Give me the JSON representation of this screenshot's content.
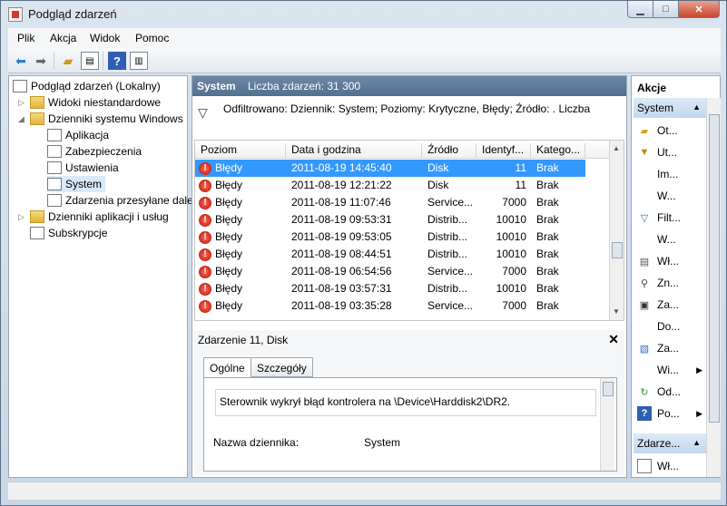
{
  "window": {
    "title": "Podgląd zdarzeń"
  },
  "menu": [
    "Plik",
    "Akcja",
    "Widok",
    "Pomoc"
  ],
  "toolbar_icons": [
    "back-arrow-icon",
    "forward-arrow-icon",
    "up-folder-icon",
    "show-hide-tree-icon",
    "help-icon",
    "show-hide-action-pane-icon"
  ],
  "tree": {
    "root": "Podgląd zdarzeń (Lokalny)",
    "custom_views": "Widoki niestandardowe",
    "windows_logs": "Dzienniki systemu Windows",
    "logs": [
      "Aplikacja",
      "Zabezpieczenia",
      "Ustawienia",
      "System",
      "Zdarzenia przesyłane dale"
    ],
    "app_logs": "Dzienniki aplikacji i usług",
    "subscriptions": "Subskrypcje"
  },
  "center": {
    "header_title": "System",
    "header_count": "Liczba zdarzeń: 31 300",
    "filter_text": "Odfiltrowano: Dziennik: System; Poziomy: Krytyczne, Błędy; Źródło: . Liczba"
  },
  "grid": {
    "columns": [
      "Poziom",
      "Data i godzina",
      "Źródło",
      "Identyf...",
      "Katego..."
    ],
    "rows": [
      {
        "level": "Błędy",
        "date": "2011-08-19 14:45:40",
        "source": "Disk",
        "id": "11",
        "category": "Brak",
        "selected": true
      },
      {
        "level": "Błędy",
        "date": "2011-08-19 12:21:22",
        "source": "Disk",
        "id": "11",
        "category": "Brak"
      },
      {
        "level": "Błędy",
        "date": "2011-08-19 11:07:46",
        "source": "Service...",
        "id": "7000",
        "category": "Brak"
      },
      {
        "level": "Błędy",
        "date": "2011-08-19 09:53:31",
        "source": "Distrib...",
        "id": "10010",
        "category": "Brak"
      },
      {
        "level": "Błędy",
        "date": "2011-08-19 09:53:05",
        "source": "Distrib...",
        "id": "10010",
        "category": "Brak"
      },
      {
        "level": "Błędy",
        "date": "2011-08-19 08:44:51",
        "source": "Distrib...",
        "id": "10010",
        "category": "Brak"
      },
      {
        "level": "Błędy",
        "date": "2011-08-19 06:54:56",
        "source": "Service...",
        "id": "7000",
        "category": "Brak"
      },
      {
        "level": "Błędy",
        "date": "2011-08-19 03:57:31",
        "source": "Distrib...",
        "id": "10010",
        "category": "Brak"
      },
      {
        "level": "Błędy",
        "date": "2011-08-19 03:35:28",
        "source": "Service...",
        "id": "7000",
        "category": "Brak"
      }
    ]
  },
  "detail": {
    "title": "Zdarzenie 11, Disk",
    "tabs": [
      "Ogólne",
      "Szczegóły"
    ],
    "message": "Sterownik wykrył błąd kontrolera na \\Device\\Harddisk2\\DR2.",
    "log_name_label": "Nazwa dziennika:",
    "log_name_value": "System"
  },
  "actions": {
    "header": "Akcje",
    "section1": "System",
    "items": [
      {
        "icon": "open-folder-icon",
        "label": "Ot..."
      },
      {
        "icon": "create-filter-icon",
        "label": "Ut..."
      },
      {
        "icon": "",
        "label": "Im..."
      },
      {
        "icon": "",
        "label": "W..."
      },
      {
        "icon": "filter-icon",
        "label": "Filt..."
      },
      {
        "icon": "",
        "label": "W..."
      },
      {
        "icon": "properties-icon",
        "label": "Wł..."
      },
      {
        "icon": "find-icon",
        "label": "Zn..."
      },
      {
        "icon": "save-icon",
        "label": "Za..."
      },
      {
        "icon": "",
        "label": "Do..."
      },
      {
        "icon": "attach-task-icon",
        "label": "Za..."
      },
      {
        "icon": "",
        "label": "Wi...",
        "submenu": true
      },
      {
        "icon": "refresh-icon",
        "label": "Od..."
      },
      {
        "icon": "help-icon",
        "label": "Po...",
        "submenu": true
      }
    ],
    "section2": "Zdarze...",
    "items2": [
      {
        "icon": "properties-icon",
        "label": "Wł..."
      }
    ]
  }
}
